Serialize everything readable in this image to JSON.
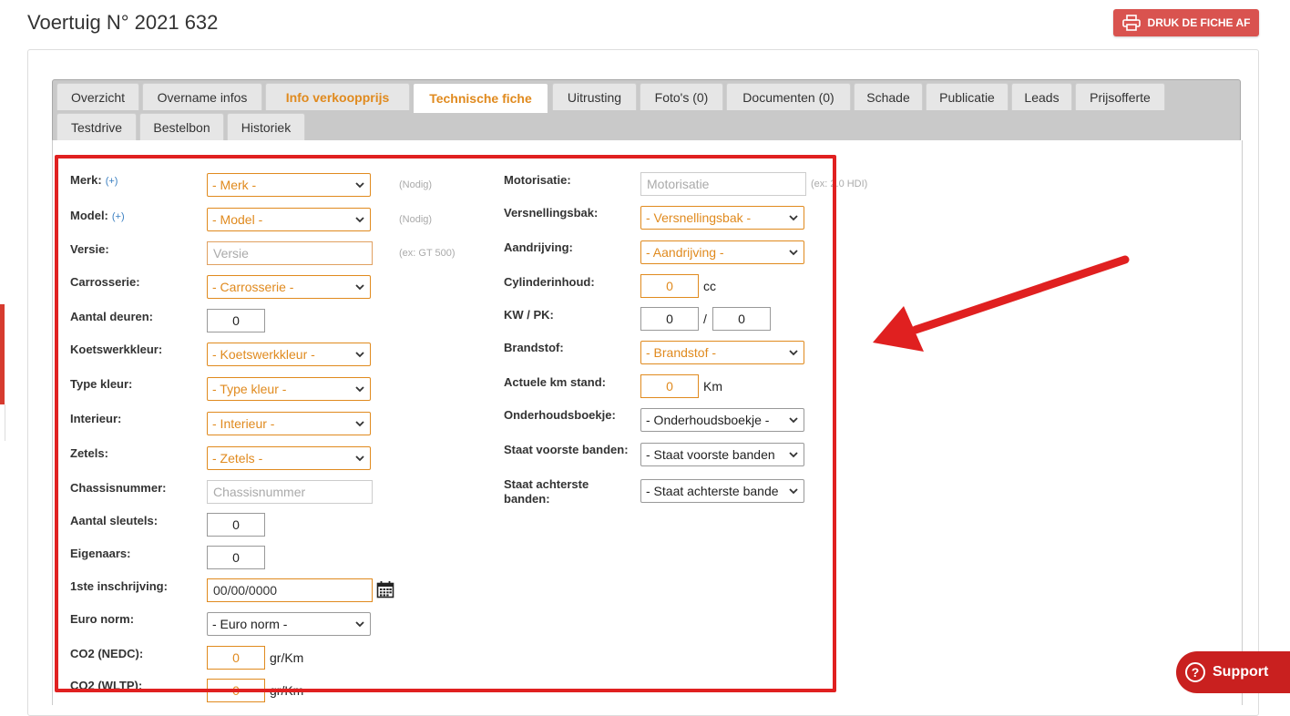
{
  "page": {
    "title": "Voertuig N° 2021 632"
  },
  "print_button": {
    "label": "DRUK DE FICHE AF"
  },
  "tabs": [
    {
      "label": "Overzicht"
    },
    {
      "label": "Overname infos"
    },
    {
      "label": "Info verkoopprijs"
    },
    {
      "label": "Technische fiche"
    },
    {
      "label": "Uitrusting"
    },
    {
      "label": "Foto's (0)"
    },
    {
      "label": "Documenten (0)"
    },
    {
      "label": "Schade"
    },
    {
      "label": "Publicatie"
    },
    {
      "label": "Leads"
    },
    {
      "label": "Prijsofferte"
    },
    {
      "label": "Testdrive"
    },
    {
      "label": "Bestelbon"
    },
    {
      "label": "Historiek"
    }
  ],
  "left_form": {
    "merk": {
      "label": "Merk:",
      "plus": "(+)",
      "value": "- Merk -",
      "hint": "(Nodig)"
    },
    "model": {
      "label": "Model:",
      "plus": "(+)",
      "value": "- Model -",
      "hint": "(Nodig)"
    },
    "versie": {
      "label": "Versie:",
      "placeholder": "Versie",
      "hint": "(ex: GT 500)"
    },
    "carrosserie": {
      "label": "Carrosserie:",
      "value": "- Carrosserie -"
    },
    "aantal_deuren": {
      "label": "Aantal deuren:",
      "value": "0"
    },
    "koetswerkkleur": {
      "label": "Koetswerkkleur:",
      "value": "- Koetswerkkleur -"
    },
    "type_kleur": {
      "label": "Type kleur:",
      "value": "- Type kleur -"
    },
    "interieur": {
      "label": "Interieur:",
      "value": "- Interieur -"
    },
    "zetels": {
      "label": "Zetels:",
      "value": "- Zetels -"
    },
    "chassisnummer": {
      "label": "Chassisnummer:",
      "placeholder": "Chassisnummer"
    },
    "aantal_sleutels": {
      "label": "Aantal sleutels:",
      "value": "0"
    },
    "eigenaars": {
      "label": "Eigenaars:",
      "value": "0"
    },
    "inschrijving": {
      "label": "1ste inschrijving:",
      "value": "00/00/0000"
    },
    "euro_norm": {
      "label": "Euro norm:",
      "value": "- Euro norm -"
    },
    "co2_nedc": {
      "label": "CO2 (NEDC):",
      "value": "0",
      "unit": "gr/Km"
    },
    "co2_wltp": {
      "label": "CO2 (WLTP):",
      "value": "0",
      "unit": "gr/Km"
    }
  },
  "right_form": {
    "motorisatie": {
      "label": "Motorisatie:",
      "placeholder": "Motorisatie",
      "hint": "(ex: 2.0 HDI)"
    },
    "versnellingsbak": {
      "label": "Versnellingsbak:",
      "value": "- Versnellingsbak -"
    },
    "aandrijving": {
      "label": "Aandrijving:",
      "value": "- Aandrijving -"
    },
    "cylinderinhoud": {
      "label": "Cylinderinhoud:",
      "value": "0",
      "unit": "cc"
    },
    "kw_pk": {
      "label": "KW / PK:",
      "kw": "0",
      "sep": "/",
      "pk": "0"
    },
    "brandstof": {
      "label": "Brandstof:",
      "value": "- Brandstof -"
    },
    "km_stand": {
      "label": "Actuele km stand:",
      "value": "0",
      "unit": "Km"
    },
    "onderhoudsboekje": {
      "label": "Onderhoudsboekje:",
      "value": "- Onderhoudsboekje -"
    },
    "voorste_banden": {
      "label": "Staat voorste banden:",
      "value": "- Staat voorste banden"
    },
    "achterste_banden": {
      "label": "Staat achterste banden:",
      "value": "- Staat achterste bande"
    }
  },
  "support": {
    "label": "Support"
  },
  "colors": {
    "accent": "#e08a1e",
    "danger": "#d9534f",
    "highlight": "#e02020"
  }
}
